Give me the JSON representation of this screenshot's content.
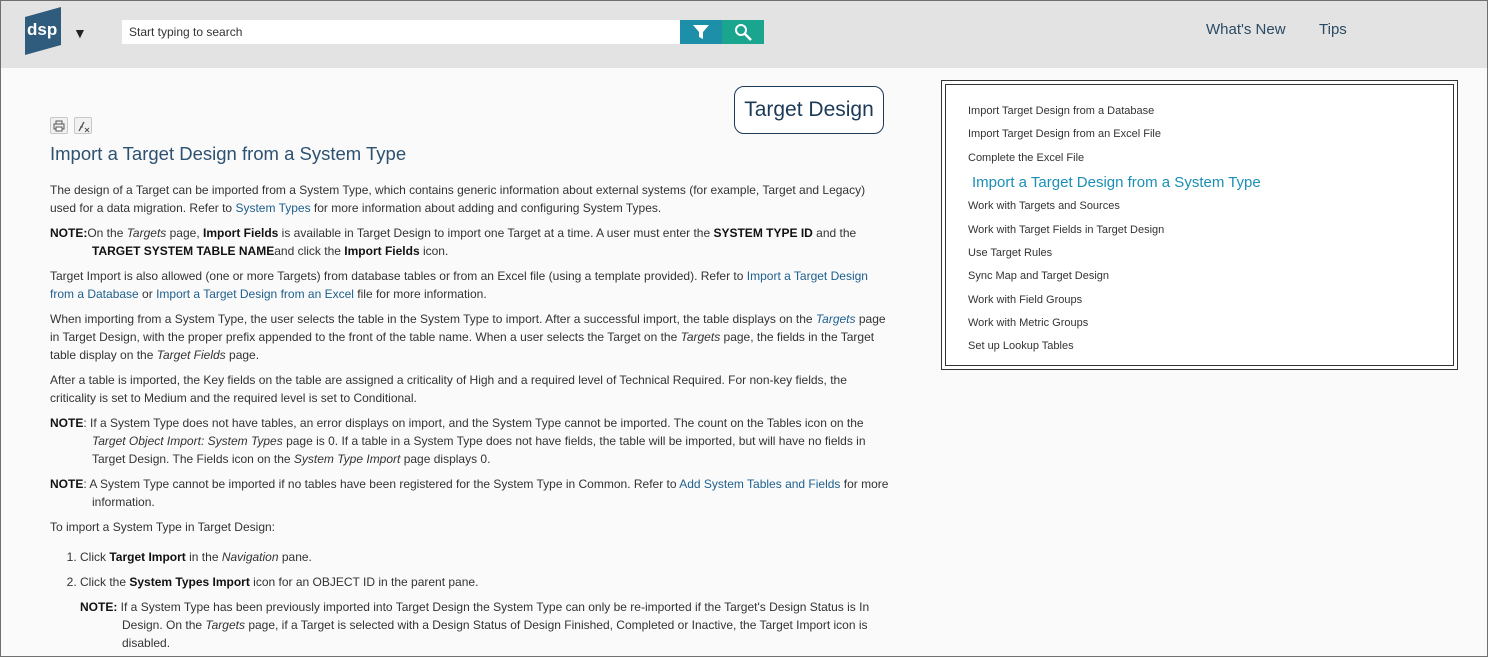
{
  "header": {
    "logo_text": "dsp",
    "logo_caret": "▼",
    "search": {
      "placeholder": "Start typing to search",
      "value": ""
    },
    "filter_icon": "filter-icon",
    "search_icon": "search-icon",
    "nav": [
      {
        "label": "What's New"
      },
      {
        "label": "Tips"
      }
    ],
    "colors": {
      "filter_btn": "#1d8fa8",
      "search_btn": "#1aa58e",
      "bar": "#e3e3e3"
    }
  },
  "main": {
    "badge": "Target Design",
    "toolbar": {
      "print_icon": "print-icon",
      "clear_icon": "clear-highlight-icon"
    },
    "title": "Import a Target Design from a System Type",
    "p1_a": "The design of a Target can be imported from a System Type, which contains generic information about external systems (for example, Target and Legacy) used for a data migration. Refer to ",
    "p1_link": "System Types",
    "p1_b": " for more information about adding and configuring System Types.",
    "note1_label": "NOTE:",
    "note1_a": "On the ",
    "note1_targets": "Targets",
    "note1_b": " page, ",
    "note1_import_fields": "Import Fields",
    "note1_c": " is available in Target Design to import one Target at a time. A user must enter the ",
    "note1_sysid": "SYSTEM TYPE ID",
    "note1_d": " and the ",
    "note1_tstn": "TARGET SYSTEM TABLE NAME",
    "note1_e": "and click the ",
    "note1_import_fields2": "Import Fields",
    "note1_f": " icon.",
    "p2_a": "Target Import is also allowed (one or more Targets) from database tables or from an Excel file (using a template provided). Refer to ",
    "p2_link1": "Import a Target Design from a Database",
    "p2_b": " or ",
    "p2_link2": "Import a Target Design from an Excel",
    "p2_c": " file for more information.",
    "p3_a": "When importing from a System Type, the user selects the table in the System Type to import. After a successful import, the table displays on the ",
    "p3_targets": "Targets",
    "p3_b": " page in Target Design, with the proper prefix appended to the front of the table name. When a user selects the Target on the ",
    "p3_targets2": "Targets",
    "p3_c": " page, the fields in the Target table display on the ",
    "p3_tf": "Target Fields",
    "p3_d": " page.",
    "p4": "After a table is imported, the Key fields on the table are assigned a criticality of High and a required level of Technical Required. For non-key fields, the criticality is set to Medium and the required level is set to Conditional.",
    "note2_label": "NOTE",
    "note2_a": ": If a System Type does not have tables, an error displays on import, and the System Type cannot be imported. The count on the Tables icon on the ",
    "note2_i": "Target Object Import: System Types",
    "note2_b": " page is 0. If a table in a System Type does not have fields, the table will be imported, but will have no fields in Target Design. The Fields icon on the ",
    "note2_i2": "System Type Import",
    "note2_c": " page displays 0.",
    "note3_label": "NOTE",
    "note3_a": ": A System Type cannot be imported if no tables have been registered for the System Type in Common. Refer to ",
    "note3_link": "Add System Tables and Fields",
    "note3_b": " for more information.",
    "p5": "To import a System Type in Target Design:",
    "step1_a": "Click ",
    "step1_b": "Target Import",
    "step1_c": " in the ",
    "step1_i": "Navigation",
    "step1_d": " pane.",
    "step2_a": "Click the ",
    "step2_b": "System Types Import",
    "step2_c": " icon for an OBJECT ID in the parent pane.",
    "note4_label": "NOTE:",
    "note4_a": " If a System Type has been previously imported into Target Design the System Type can only be re-imported if the Target's Design Status is In Design. On the ",
    "note4_i": "Targets",
    "note4_b": " page, if a Target is selected with a Design Status of Design Finished, Completed or Inactive, the Target Import icon is disabled."
  },
  "sidebar": {
    "items": [
      {
        "label": "Import Target Design from a Database"
      },
      {
        "label": "Import Target Design from an Excel File"
      },
      {
        "label": "Complete the Excel File"
      },
      {
        "label": "Import a Target Design from a System Type"
      },
      {
        "label": "Work with Targets and Sources"
      },
      {
        "label": "Work with Target Fields in Target Design"
      },
      {
        "label": "Use Target Rules"
      },
      {
        "label": "Sync Map and Target Design"
      },
      {
        "label": "Work with Field Groups"
      },
      {
        "label": "Work with Metric Groups"
      },
      {
        "label": "Set up Lookup Tables"
      }
    ],
    "active_color": "#1a8fb5"
  }
}
